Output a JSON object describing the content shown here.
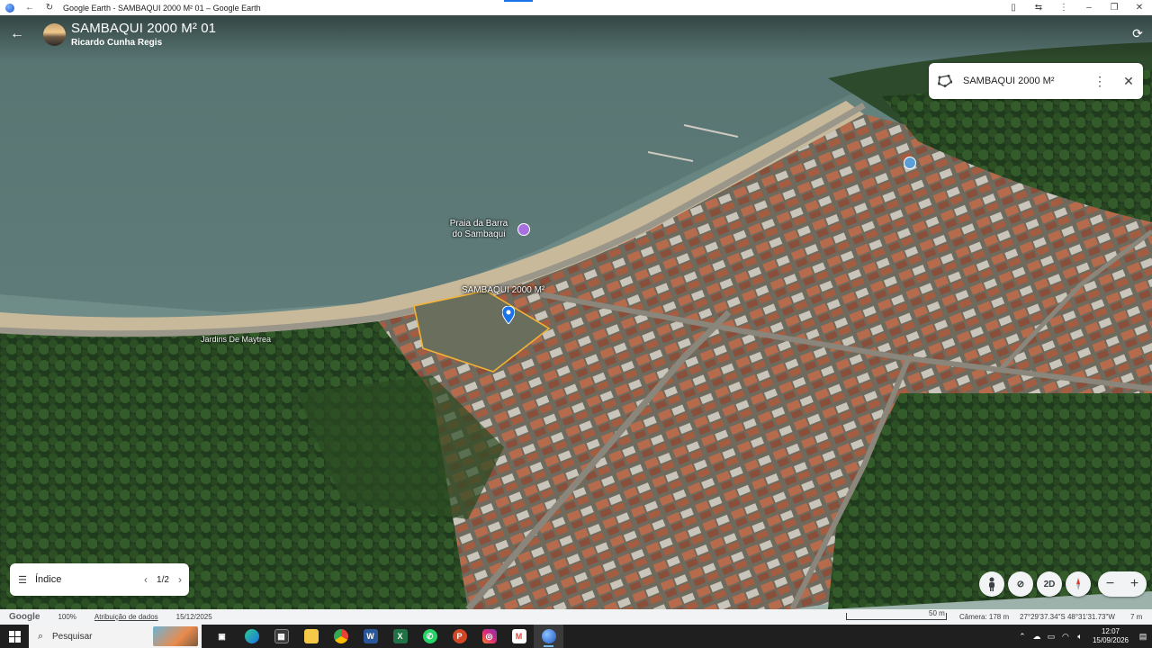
{
  "window": {
    "title": "Google Earth - SAMBAQUI 2000 M² 01 – Google Earth"
  },
  "header": {
    "project_title": "SAMBAQUI 2000 M² 01",
    "author": "Ricardo Cunha Regis"
  },
  "feature_card": {
    "title": "SAMBAQUI 2000 M²"
  },
  "map_labels": {
    "beach": "Praia da Barra\ndo Sambaqui",
    "beach_line1": "Praia da Barra",
    "beach_line2": "do Sambaqui",
    "polygon": "SAMBAQUI 2000 M²",
    "road": "Jardins De Maytrea"
  },
  "index_panel": {
    "label": "Índice",
    "page": "1/2"
  },
  "controls": {
    "mode_2d": "2D"
  },
  "statusbar": {
    "logo": "Google",
    "zoom": "100%",
    "attribution": "Atribuição de dados",
    "date": "15/12/2025",
    "scale": "50 m",
    "camera": "Câmera: 178 m",
    "coords": "27°29'37.34\"S 48°31'31.73\"W",
    "altitude": "7 m"
  },
  "taskbar": {
    "search_placeholder": "Pesquisar",
    "time": "12:07",
    "date": "15/09/2026"
  },
  "colors": {
    "polygon_outline": "#f2b233",
    "marker": "#1a73e8",
    "poi": "#a86fe0"
  }
}
